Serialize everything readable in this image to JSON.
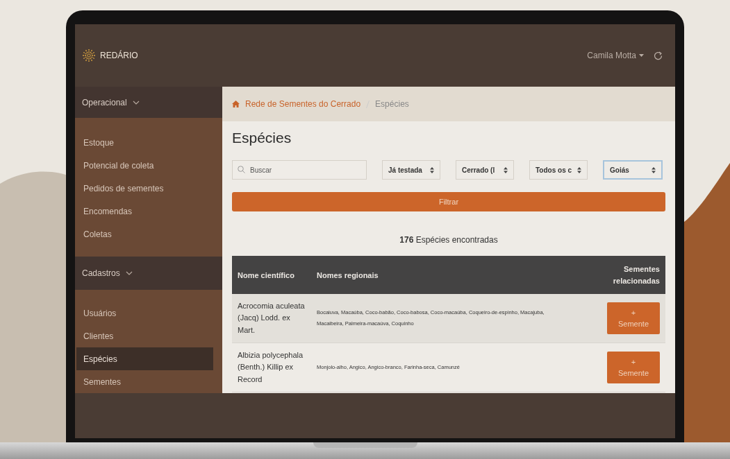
{
  "app": {
    "brand": "REDÁRIO",
    "user": "Camila Motta"
  },
  "sidebar": {
    "groups": [
      {
        "label": "Operacional",
        "expanded": true,
        "items": [
          {
            "label": "Estoque",
            "selected": false
          },
          {
            "label": "Potencial de coleta",
            "selected": false
          },
          {
            "label": "Pedidos de sementes",
            "selected": false
          },
          {
            "label": "Encomendas",
            "selected": false
          },
          {
            "label": "Coletas",
            "selected": false
          }
        ]
      },
      {
        "label": "Cadastros",
        "expanded": true,
        "items": [
          {
            "label": "Usuários",
            "selected": false
          },
          {
            "label": "Clientes",
            "selected": false
          },
          {
            "label": "Espécies",
            "selected": true
          },
          {
            "label": "Sementes",
            "selected": false
          }
        ]
      }
    ]
  },
  "breadcrumb": [
    "Rede de Sementes do Cerrado",
    "Espécies"
  ],
  "page_title": "Espécies",
  "filters": {
    "search": {
      "placeholder": "Buscar"
    },
    "selects": [
      {
        "value": "Já testada",
        "focused": false
      },
      {
        "value": "Cerrado (l",
        "focused": false
      },
      {
        "value": "Todos os c",
        "focused": false
      },
      {
        "value": "Goiás",
        "focused": true
      }
    ]
  },
  "filter_button": "Filtrar",
  "result_count": "**176** Espécies encontradas",
  "table": {
    "columns": [
      "Nome científico",
      "Nomes regionais",
      "Sementes relacionadas"
    ],
    "rows": [
      {
        "scientific_name": "Acrocomia aculeata (Jacq) Lodd. ex Mart.",
        "regional_names": "Bocaiuva, Macaúba, Coco-babão, Coco-babosa, Coco-macaúba, Coqueiro-de-espinho, Macajuba, Macaibeira, Palmeira-macaúva, Coquinho",
        "action": {
          "icon": "+",
          "label": "Semente"
        }
      },
      {
        "scientific_name": "Albizia polycephala (Benth.) Killip ex Record",
        "regional_names": "Monjolo-alho, Angico, Angico-branco, Farinha-seca, Camunzé",
        "action": {
          "icon": "+",
          "label": "Semente"
        }
      }
    ]
  }
}
